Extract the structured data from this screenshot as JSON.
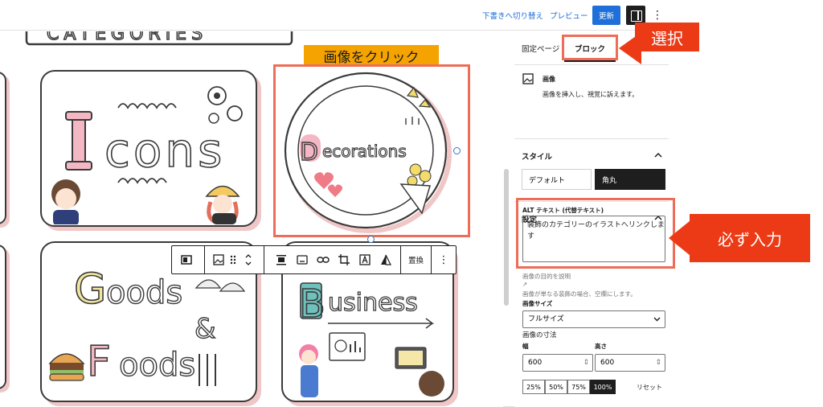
{
  "topbar": {
    "switch_draft": "下書きへ切り替え",
    "preview": "プレビュー",
    "update": "更新"
  },
  "canvas": {
    "callout": "画像をクリック",
    "cards": [
      {
        "text": "Icons"
      },
      {
        "text": "Decorations"
      },
      {
        "text": "Goods & Foods"
      },
      {
        "text": "Business"
      }
    ],
    "heading_partial": "CATEGORIES"
  },
  "toolbar": {
    "replace": "置換"
  },
  "sidebar": {
    "tabs": [
      "固定ページ",
      "ブロック"
    ],
    "block_name": "画像",
    "block_desc": "画像を挿入し、視覚に訴えます。",
    "style_title": "スタイル",
    "style_default": "デフォルト",
    "style_rounded": "角丸",
    "settings_title": "設定",
    "alt_label": "ALT テキスト (代替テキスト)",
    "alt_value": "装飾のカテゴリーのイラストへリンクしま\nす",
    "alt_help_link": "画像の目的を説明",
    "alt_help": "画像が単なる装飾の場合、空欄にします。",
    "size_label": "画像サイズ",
    "size_value": "フルサイズ",
    "dims_label": "画像の寸法",
    "width_label": "幅",
    "height_label": "高さ",
    "width_value": "600",
    "height_value": "600",
    "percents": [
      "25%",
      "50%",
      "75%",
      "100%"
    ],
    "reset": "リセット"
  },
  "annotations": {
    "select": "選択",
    "must_input": "必ず入力"
  },
  "colors": {
    "accent": "#1e6fd9",
    "highlight_red": "#ee6d59",
    "callout_red": "#ed3a16",
    "callout_orange": "#f5a300"
  }
}
